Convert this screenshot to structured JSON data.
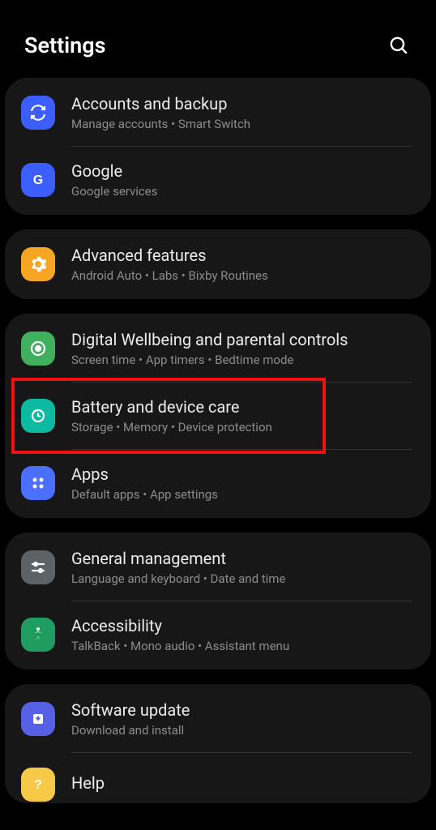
{
  "header": {
    "title": "Settings"
  },
  "groups": [
    {
      "items": [
        {
          "id": "accounts-backup",
          "title": "Accounts and backup",
          "subtitle": "Manage accounts  •  Smart Switch"
        },
        {
          "id": "google",
          "title": "Google",
          "subtitle": "Google services"
        }
      ]
    },
    {
      "items": [
        {
          "id": "advanced-features",
          "title": "Advanced features",
          "subtitle": "Android Auto  •  Labs  •  Bixby Routines"
        }
      ]
    },
    {
      "items": [
        {
          "id": "digital-wellbeing",
          "title": "Digital Wellbeing and parental controls",
          "subtitle": "Screen time  •  App timers  •  Bedtime mode"
        },
        {
          "id": "battery-device-care",
          "title": "Battery and device care",
          "subtitle": "Storage  •  Memory  •  Device protection",
          "highlighted": true
        },
        {
          "id": "apps",
          "title": "Apps",
          "subtitle": "Default apps  •  App settings"
        }
      ]
    },
    {
      "items": [
        {
          "id": "general-management",
          "title": "General management",
          "subtitle": "Language and keyboard  •  Date and time"
        },
        {
          "id": "accessibility",
          "title": "Accessibility",
          "subtitle": "TalkBack  •  Mono audio  •  Assistant menu"
        }
      ]
    },
    {
      "items": [
        {
          "id": "software-update",
          "title": "Software update",
          "subtitle": "Download and install"
        },
        {
          "id": "help",
          "title": "Help",
          "subtitle": ""
        }
      ]
    }
  ]
}
